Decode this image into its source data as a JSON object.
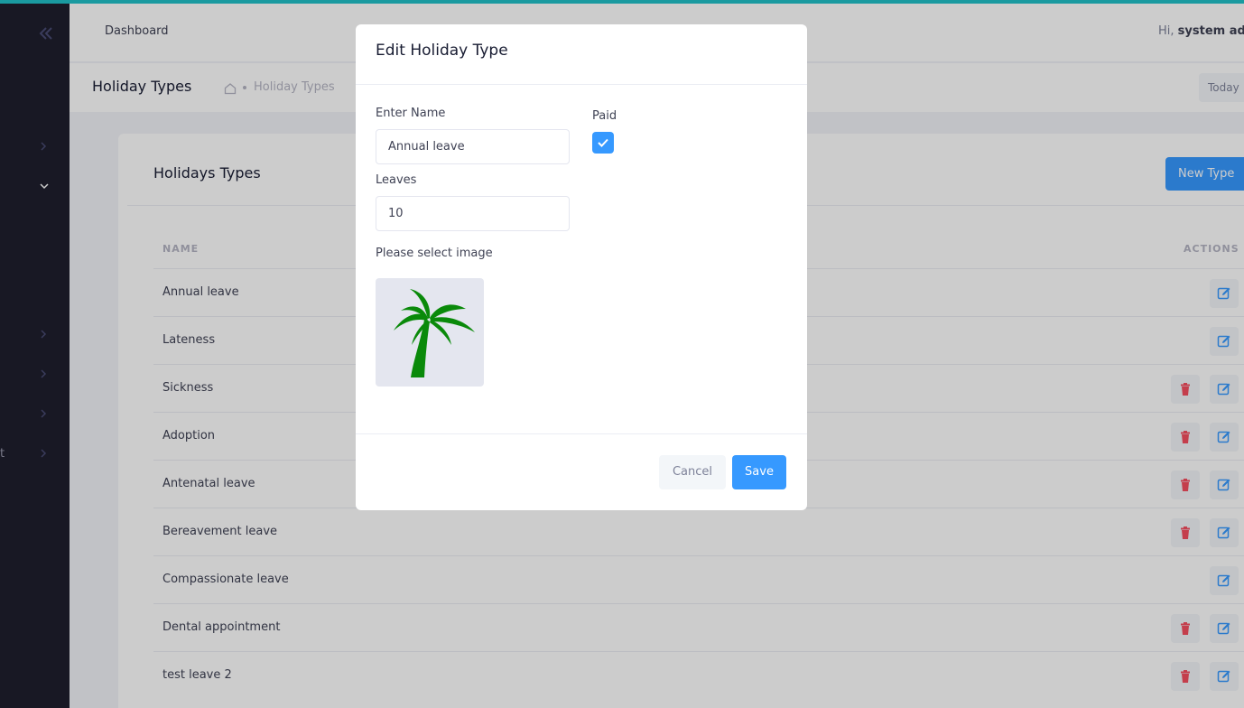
{
  "header": {
    "dashboard_link": "Dashboard",
    "greeting": "Hi,",
    "user_name": "system adr"
  },
  "sidebar": {
    "partial_label": "t"
  },
  "subheader": {
    "title": "Holiday Types",
    "breadcrumb": "Holiday Types",
    "today_button": "Today"
  },
  "card": {
    "title": "Holidays Types",
    "new_button": "New Type",
    "columns": {
      "name": "NAME",
      "actions": "ACTIONS"
    },
    "rows": [
      {
        "name": "Annual leave",
        "deletable": false
      },
      {
        "name": "Lateness",
        "deletable": false
      },
      {
        "name": "Sickness",
        "deletable": true
      },
      {
        "name": "Adoption",
        "deletable": true
      },
      {
        "name": "Antenatal leave",
        "deletable": true
      },
      {
        "name": "Bereavement leave",
        "deletable": true
      },
      {
        "name": "Compassionate leave",
        "deletable": false
      },
      {
        "name": "Dental appointment",
        "deletable": true
      },
      {
        "name": "test leave 2",
        "deletable": true
      }
    ]
  },
  "modal": {
    "title": "Edit Holiday Type",
    "name_label": "Enter Name",
    "name_value": "Annual leave",
    "paid_label": "Paid",
    "paid_checked": true,
    "leaves_label": "Leaves",
    "leaves_value": "10",
    "image_label": "Please select image",
    "image_icon": "palm-tree-icon",
    "cancel_label": "Cancel",
    "save_label": "Save"
  },
  "colors": {
    "primary": "#3699ff",
    "danger": "#f64e60",
    "sidebar_bg": "#1e1e2d",
    "palm": "#0a8a0a",
    "top_strip": "#1a9aa0"
  }
}
